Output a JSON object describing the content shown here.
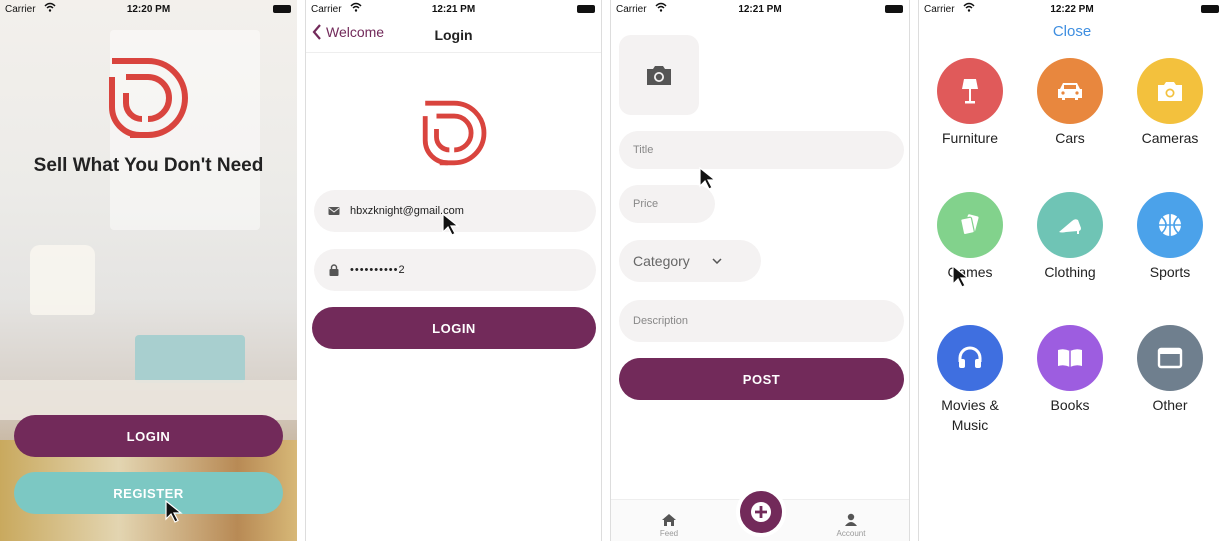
{
  "status_bars": [
    {
      "carrier": "Carrier",
      "time": "12:20 PM"
    },
    {
      "carrier": "Carrier",
      "time": "12:21 PM"
    },
    {
      "carrier": "Carrier",
      "time": "12:21 PM"
    },
    {
      "carrier": "Carrier",
      "time": "12:22 PM"
    }
  ],
  "welcome": {
    "tagline": "Sell What You Don't Need",
    "login_label": "LOGIN",
    "register_label": "REGISTER"
  },
  "login": {
    "back_label": "Welcome",
    "title": "Login",
    "email_value": "hbxzknight@gmail.com",
    "password_value": "••••••••••2",
    "login_button": "LOGIN"
  },
  "post": {
    "title_placeholder": "Title",
    "price_placeholder": "Price",
    "category_label": "Category",
    "description_placeholder": "Description",
    "post_button": "POST",
    "tabs": {
      "feed": "Feed",
      "account": "Account"
    }
  },
  "categories": {
    "close_label": "Close",
    "items": [
      {
        "label": "Furniture",
        "color": "#e05a5a",
        "icon": "lamp-icon"
      },
      {
        "label": "Cars",
        "color": "#e8873e",
        "icon": "car-icon"
      },
      {
        "label": "Cameras",
        "color": "#f3c13d",
        "icon": "camera-icon"
      },
      {
        "label": "Games",
        "color": "#82d28c",
        "icon": "cards-icon"
      },
      {
        "label": "Clothing",
        "color": "#6fc4b5",
        "icon": "shoe-icon"
      },
      {
        "label": "Sports",
        "color": "#4ba2ea",
        "icon": "basketball-icon"
      },
      {
        "label": "Movies & Music",
        "color": "#3f6fe0",
        "icon": "headphones-icon"
      },
      {
        "label": "Books",
        "color": "#9d5de0",
        "icon": "book-icon"
      },
      {
        "label": "Other",
        "color": "#6f7f8e",
        "icon": "window-icon"
      }
    ]
  },
  "colors": {
    "primary": "#722a5a",
    "secondary": "#7cc8c3",
    "brand_red": "#d9443e",
    "link_blue": "#3e8ee0"
  }
}
